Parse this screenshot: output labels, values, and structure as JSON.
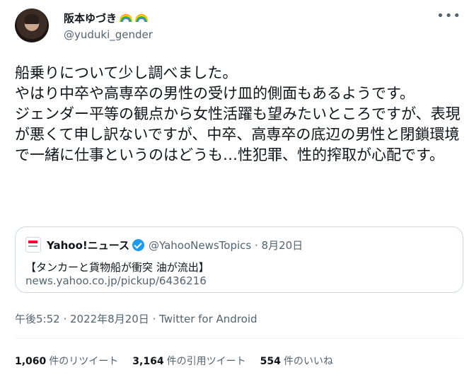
{
  "user": {
    "name": "阪本ゆづき",
    "handle": "@yuduki_gender"
  },
  "tweet": {
    "text": "船乗りについて少し調べました。\nやはり中卒や高専卒の男性の受け皿的側面もあるようです。\nジェンダー平等の観点から女性活躍も望みたいところですが、表現が悪くて申し訳ないですが、中卒、高専卒の底辺の男性と閉鎖環境で一緒に仕事というのはどうも…性犯罪、性的搾取が心配です。"
  },
  "card": {
    "name": "Yahoo!ニュース",
    "meta": "@YahooNewsTopics · 8月20日",
    "headline": "【タンカーと貨物船が衝突 油が流出】",
    "link": "news.yahoo.co.jp/pickup/6436216"
  },
  "timestamp": "午後5:52 · 2022年8月20日 · Twitter for Android",
  "stats": {
    "retweets_count": "1,060",
    "retweets_label": "件のリツイート",
    "quotes_count": "3,164",
    "quotes_label": "件の引用ツイート",
    "likes_count": "554",
    "likes_label": "件のいいね"
  },
  "icons": [
    "rainbow-flag-icon",
    "more-icon",
    "verified-icon",
    "yahoo-logo-icon"
  ],
  "colors": {
    "verified": "#1d9bf0",
    "muted": "#536471",
    "border": "#cfd9de"
  }
}
